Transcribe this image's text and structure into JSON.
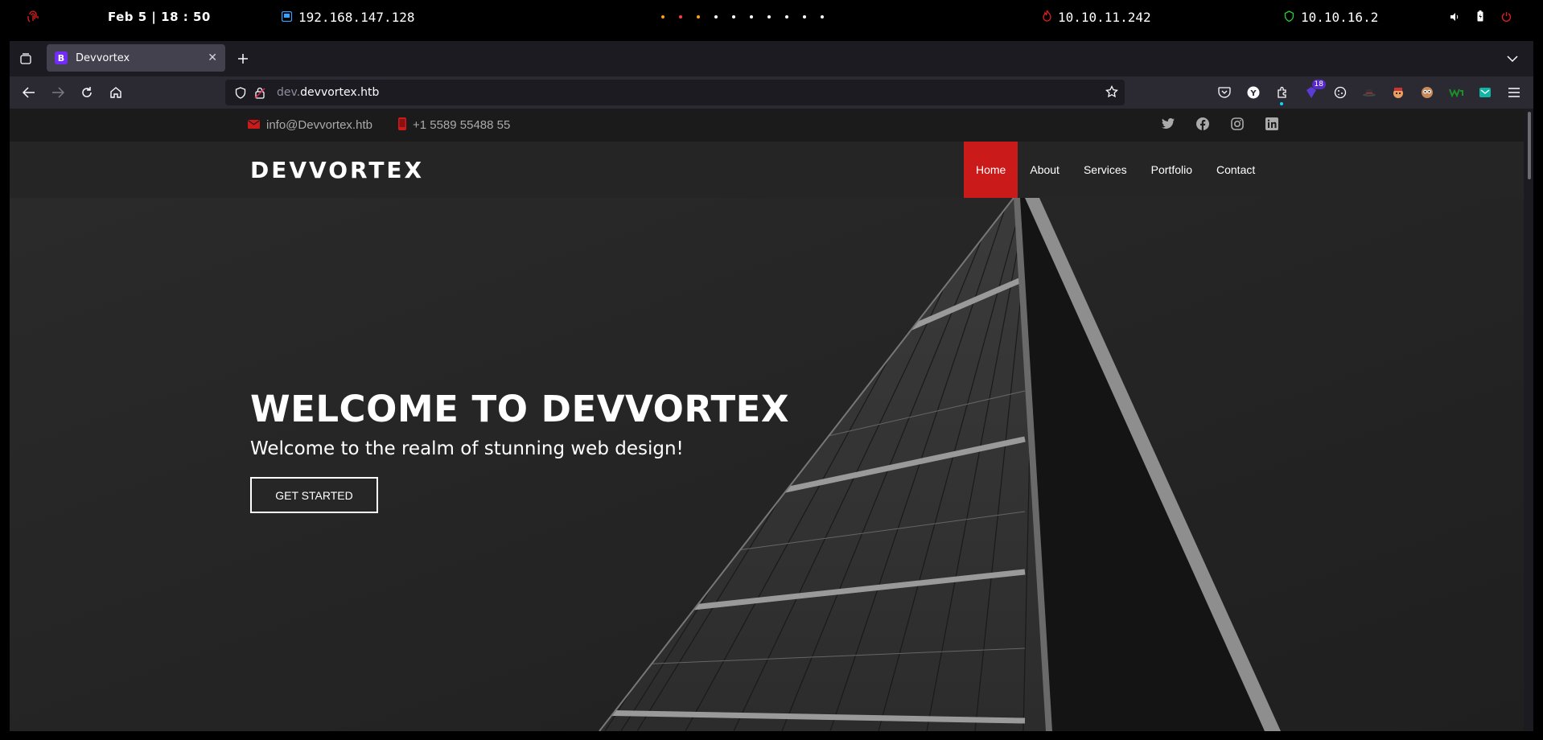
{
  "system_bar": {
    "clock": "Feb 5 | 18 : 50",
    "ip_local": "192.168.147.128",
    "ip_target": "10.10.11.242",
    "ip_vpn": "10.10.16.2",
    "icons": [
      "fingerprint-icon",
      "network-icon",
      "flame-icon",
      "shield-check-icon",
      "volume-icon",
      "battery-icon",
      "power-icon"
    ],
    "workspace_dot_colors": [
      "#ff9f1a",
      "#ff3b3b",
      "#ff9f1a",
      "#ffffff",
      "#ffffff",
      "#ffffff",
      "#ffffff",
      "#ffffff",
      "#ffffff",
      "#ffffff"
    ]
  },
  "browser": {
    "tab": {
      "title": "Devvortex",
      "favicon": "B"
    },
    "url": {
      "subdomain": "dev.",
      "domain": "devvortex.htb"
    },
    "extension_badge": "18"
  },
  "site": {
    "topbar": {
      "email": "info@Devvortex.htb",
      "phone": "+1 5589 55488 55",
      "social": [
        "twitter-icon",
        "facebook-icon",
        "instagram-icon",
        "linkedin-icon"
      ]
    },
    "logo": "DEVVORTEX",
    "nav": [
      "Home",
      "About",
      "Services",
      "Portfolio",
      "Contact"
    ],
    "hero": {
      "title": "WELCOME TO DEVVORTEX",
      "subtitle": "Welcome to the realm of stunning web design!",
      "cta": "GET STARTED"
    },
    "accent_color": "#ca1a1a"
  }
}
